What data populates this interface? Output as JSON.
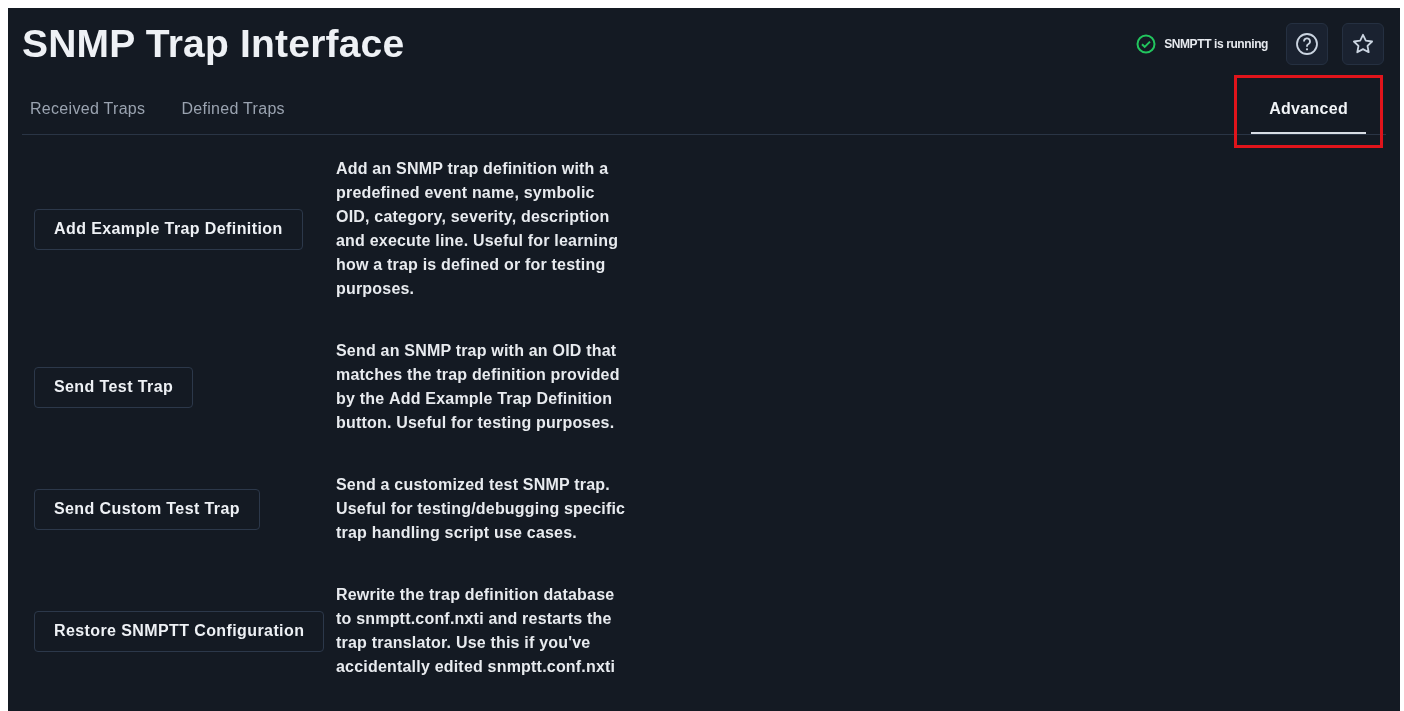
{
  "header": {
    "title": "SNMP Trap Interface",
    "status": {
      "text": "SNMPTT is running",
      "running": true
    }
  },
  "tabs": [
    {
      "label": "Received Traps",
      "selected": false,
      "highlighted": false
    },
    {
      "label": "Defined Traps",
      "selected": false,
      "highlighted": false
    },
    {
      "label": "Advanced",
      "selected": true,
      "highlighted": true
    }
  ],
  "actions": [
    {
      "button": "Add Example Trap Definition",
      "description": "Add an SNMP trap definition with a predefined event name, symbolic OID, category, severity, description and execute line. Useful for learning how a trap is defined or for testing purposes."
    },
    {
      "button": "Send Test Trap",
      "description": "Send an SNMP trap with an OID that matches the trap definition provided by the **Add Example Trap Definition** button. Useful for testing purposes."
    },
    {
      "button": "Send Custom Test Trap",
      "description": "Send a customized test SNMP trap. Useful for testing/debugging specific trap handling script use cases."
    },
    {
      "button": "Restore SNMPTT Configuration",
      "description": "Rewrite the trap definition database to snmptt.conf.nxti and restarts the trap translator. Use this if you've accidentally edited snmptt.conf.nxti"
    }
  ]
}
